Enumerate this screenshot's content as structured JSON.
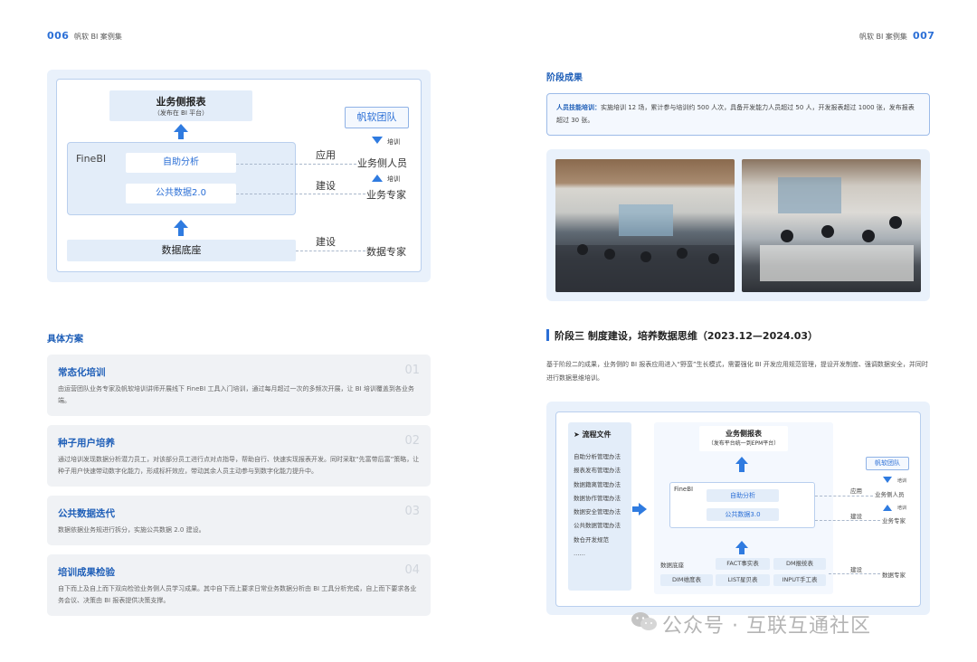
{
  "left_header": {
    "page": "006",
    "title": "帆软 BI 案例集"
  },
  "right_header": {
    "page": "007",
    "title": "帆软 BI 案例集"
  },
  "diagram1": {
    "top_title": "业务侧报表",
    "top_sub": "（发布在 BI 平台）",
    "finebi": "FineBI",
    "self_analysis": "自助分析",
    "public_data": "公共数据2.0",
    "data_base": "数据底座",
    "team": "帆软团队",
    "train1": "培训",
    "biz_staff": "业务侧人员",
    "train2": "培训",
    "biz_expert": "业务专家",
    "data_expert": "数据专家",
    "apply": "应用",
    "build1": "建设",
    "build2": "建设"
  },
  "plan_title": "具体方案",
  "cards": [
    {
      "title": "常态化培训",
      "num": "01",
      "body": "由运营团队业务专家及帆软培训讲师开展线下 FineBI 工具入门培训，通过每月超过一次的多频次开展，让 BI 培训覆盖到各业务端。"
    },
    {
      "title": "种子用户培养",
      "num": "02",
      "body": "通过培训发现数据分析潜力员工，对该部分员工进行点对点指导，帮助自行、快速实现报表开发。同时采取“先富带后富”策略，让种子用户快速带动数字化能力，形成标杆效应，带动其余人员主动参与到数字化能力提升中。"
    },
    {
      "title": "公共数据迭代",
      "num": "03",
      "body": "数据依据业务规进行拆分，实施公共数据 2.0 建设。"
    },
    {
      "title": "培训成果检验",
      "num": "04",
      "body": "自下而上及自上而下双向检验业务侧人员学习成果。其中自下而上要求日常业务数据分析由 BI 工具分析完成，自上而下要求各业务会议、决策由 BI 报表提供决策支撑。"
    }
  ],
  "results": {
    "title": "阶段成果",
    "label": "人员技能培训：",
    "text": "实施培训 12 场，累计参与培训约 500 人次，具备开发能力人员超过 50 人，开发报表超过 1000 张，发布报表超过 30 张。"
  },
  "stage3": {
    "title": "阶段三 制度建设，培养数据思维（2023.12—2024.03）",
    "body": "基于阶段二的成果，业务侧的 BI 报表应用进入“野蛮”生长模式，需要强化 BI 开发应用规范管理，提设开发制度、强调数据安全，并同时进行数据思维培训。"
  },
  "diagram2": {
    "flow_title": "流程文件",
    "flow_items": [
      "自助分析管理办法",
      "报表发布管理办法",
      "数据籍离管理办法",
      "数据协作管理办法",
      "数据安全管理办法",
      "公共数据管理办法",
      "数仓开发规范",
      "……"
    ],
    "top_title": "业务侧报表",
    "top_sub": "（发布平台统一到EPM平台）",
    "finebi": "FineBI",
    "self_analysis": "自助分析",
    "public_data": "公共数据3.0",
    "base_title": "数据底座",
    "fact": "FACT事实表",
    "dm": "DM报统表",
    "dim": "DIM维度表",
    "list": "LIST星贝表",
    "input": "INPUT手工表",
    "team": "帆软团队",
    "train1": "培训",
    "biz_staff": "业务侧人员",
    "train2": "培训",
    "biz_expert": "业务专家",
    "data_expert": "数据专家",
    "apply": "应用",
    "build1": "建设",
    "build2": "建设"
  },
  "watermark": "公众号 · 互联互通社区",
  "colors": {
    "accent": "#2b6fd6",
    "panel": "#e9f1fb"
  }
}
